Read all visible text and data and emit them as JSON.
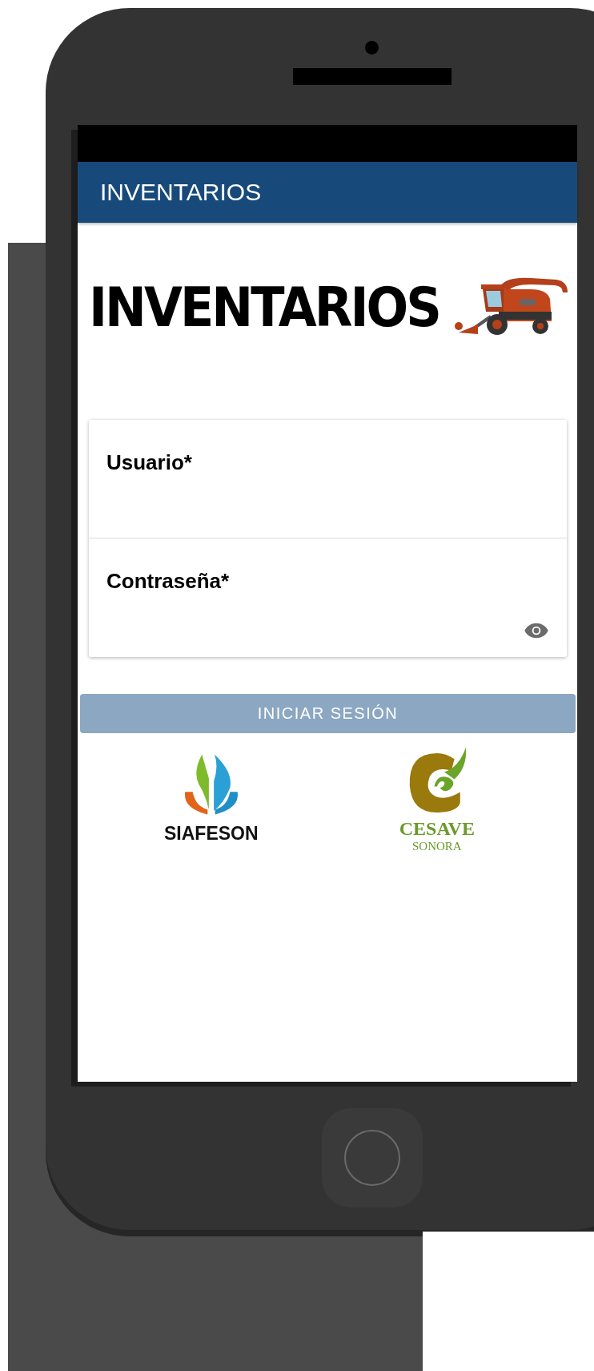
{
  "app_bar": {
    "title": "INVENTARIOS"
  },
  "banner": {
    "title": "INVENTARIOS"
  },
  "fields": [
    {
      "label": "Usuario*",
      "kind": "text"
    },
    {
      "label": "Contraseña*",
      "kind": "password"
    }
  ],
  "login_button": {
    "label": "INICIAR SESIÓN",
    "disabled": true
  },
  "partner_logos": [
    {
      "kind": "siafeson",
      "name": "SIAFESON"
    },
    {
      "kind": "cesave",
      "name": "CESAVE",
      "subtitle": "SONORA"
    }
  ]
}
